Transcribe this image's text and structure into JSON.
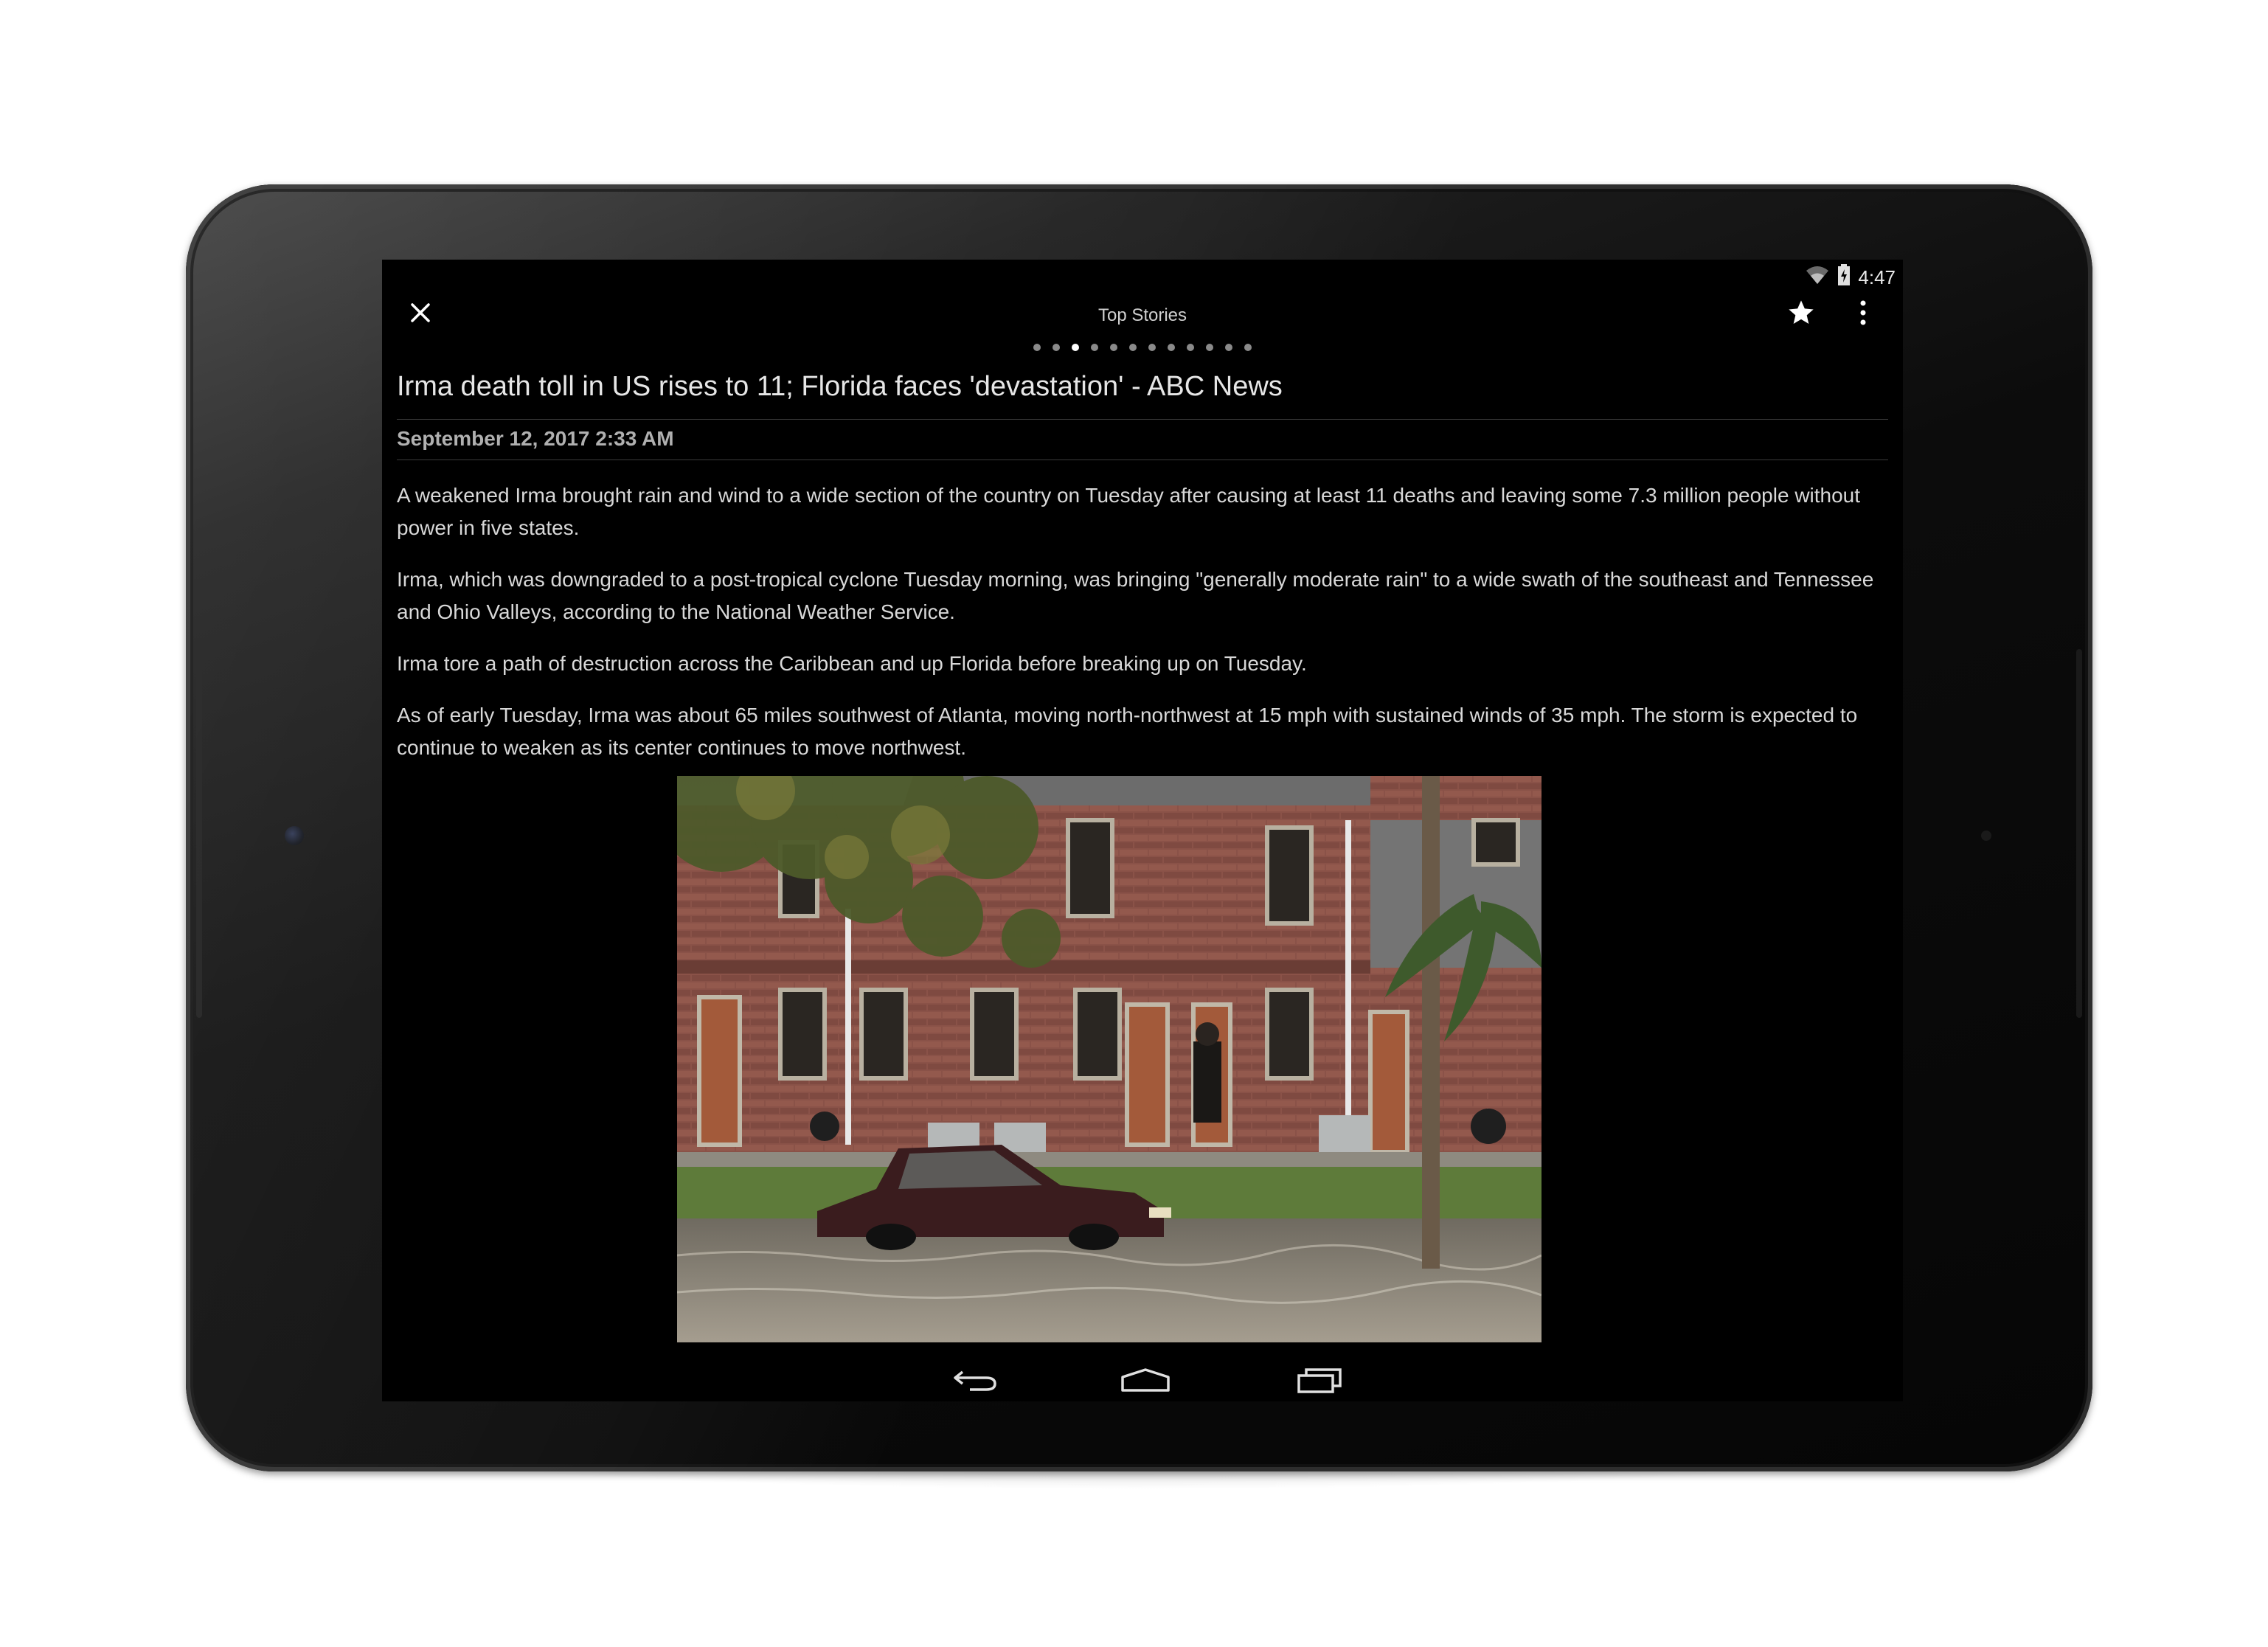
{
  "status_bar": {
    "time": "4:47",
    "icons": [
      "wifi-icon",
      "battery-charging-icon"
    ]
  },
  "toolbar": {
    "title": "Top Stories",
    "actions": [
      "close-icon",
      "star-icon",
      "overflow-menu-icon"
    ]
  },
  "pager": {
    "total_pages": 12,
    "active_index": 2
  },
  "article": {
    "headline": "Irma death toll in US rises to 11; Florida faces 'devastation' - ABC News",
    "date": "September 12, 2017 2:33 AM",
    "paragraphs": [
      "A weakened Irma brought rain and wind to a wide section of the country on Tuesday after causing at least 11 deaths and leaving some 7.3 million people without power in five states.",
      "Irma, which was downgraded to a post-tropical cyclone Tuesday morning, was bringing \"generally moderate rain\" to a wide swath of the southeast and Tennessee and Ohio Valleys, according to the National Weather Service.",
      "Irma tore a path of destruction across the Caribbean and up Florida before breaking up on Tuesday.",
      "As of early Tuesday, Irma was about 65 miles southwest of Atlanta, moving north-northwest at 15 mph with sustained winds of 35 mph. The storm is expected to continue to weaken as its center continues to move northwest."
    ]
  },
  "navigation_bar": {
    "buttons": [
      "back-icon",
      "home-icon",
      "recents-icon"
    ]
  },
  "colors": {
    "screen_background": "#000000",
    "text_primary": "#e6e6e6",
    "text_secondary": "#b0b0b0",
    "divider": "#3c3c3c"
  }
}
